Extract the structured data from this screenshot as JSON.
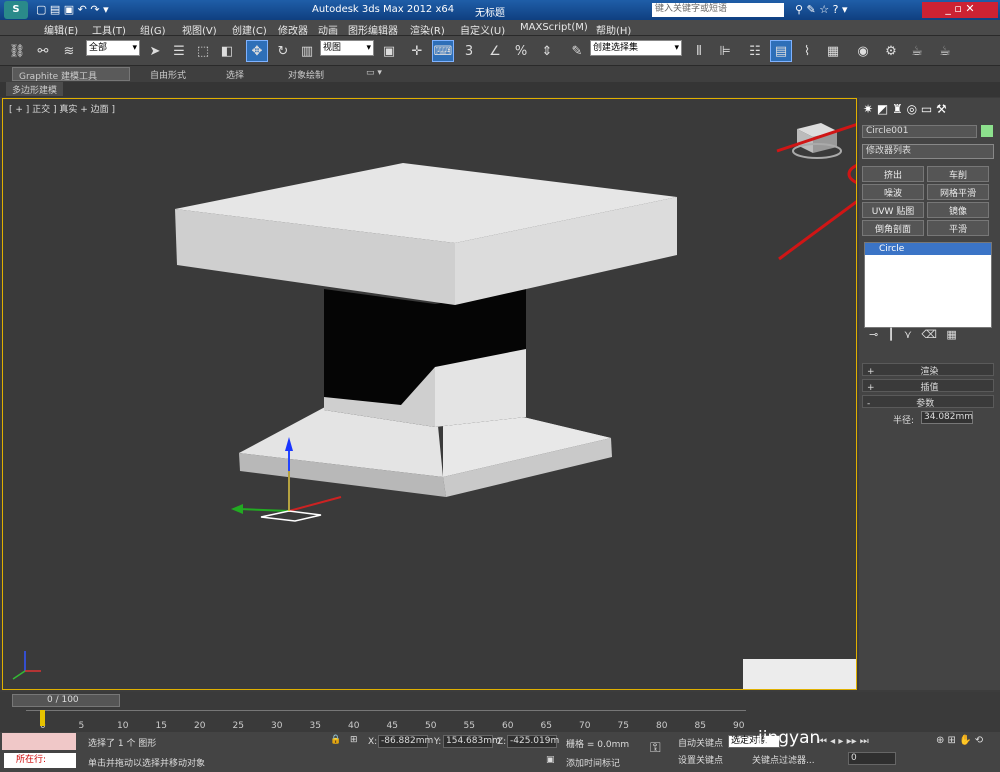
{
  "title": {
    "app": "Autodesk 3ds Max 2012 x64",
    "doc": "无标题",
    "search_placeholder": "键入关键字或短语"
  },
  "menus": [
    "编辑(E)",
    "工具(T)",
    "组(G)",
    "视图(V)",
    "创建(C)",
    "修改器",
    "动画",
    "图形编辑器",
    "渲染(R)",
    "自定义(U)",
    "MAXScript(M)",
    "帮助(H)"
  ],
  "toolbar": {
    "selection_filter": "全部",
    "ref_coord": "视图",
    "named_selection": "创建选择集"
  },
  "ribbon": {
    "tabs": [
      "Graphite 建模工具",
      "自由形式",
      "选择",
      "对象绘制"
    ],
    "subtab": "多边形建模"
  },
  "viewport": {
    "label": "[ + ] 正交 ] 真实 + 边面 ]"
  },
  "panel": {
    "object_name": "Circle001",
    "object_color": "#8de08d",
    "modifier_list": "修改器列表",
    "buttons": [
      "挤出",
      "车削",
      "噪波",
      "网格平滑",
      "UVW 贴图",
      "镜像",
      "倒角剖面",
      "平滑"
    ],
    "stack_item": "Circle",
    "rollouts": {
      "render": "渲染",
      "interp": "插值",
      "params": "参数"
    },
    "radius_label": "半径:",
    "radius_value": "34.082mm"
  },
  "timeline": {
    "frame": "0 / 100",
    "ticks": [
      "0",
      "5",
      "10",
      "15",
      "20",
      "25",
      "30",
      "35",
      "40",
      "45",
      "50",
      "55",
      "60",
      "65",
      "70",
      "75",
      "80",
      "85",
      "90"
    ]
  },
  "status": {
    "running": "所在行:",
    "selected": "选择了 1 个 图形",
    "hint": "单击并拖动以选择并移动对象",
    "x_label": "X:",
    "x": "-86.882mm",
    "y_label": "Y:",
    "y": "154.683mm",
    "z_label": "Z:",
    "z": "-425.019m",
    "grid": "栅格 = 0.0mm",
    "autokey": "自动关键点",
    "selected_obj": "选定对象",
    "setkey": "设置关键点",
    "keyfilter": "关键点过滤器...",
    "addtime": "添加时间标记",
    "frame_field": "0",
    "watermark": "jingyan"
  }
}
